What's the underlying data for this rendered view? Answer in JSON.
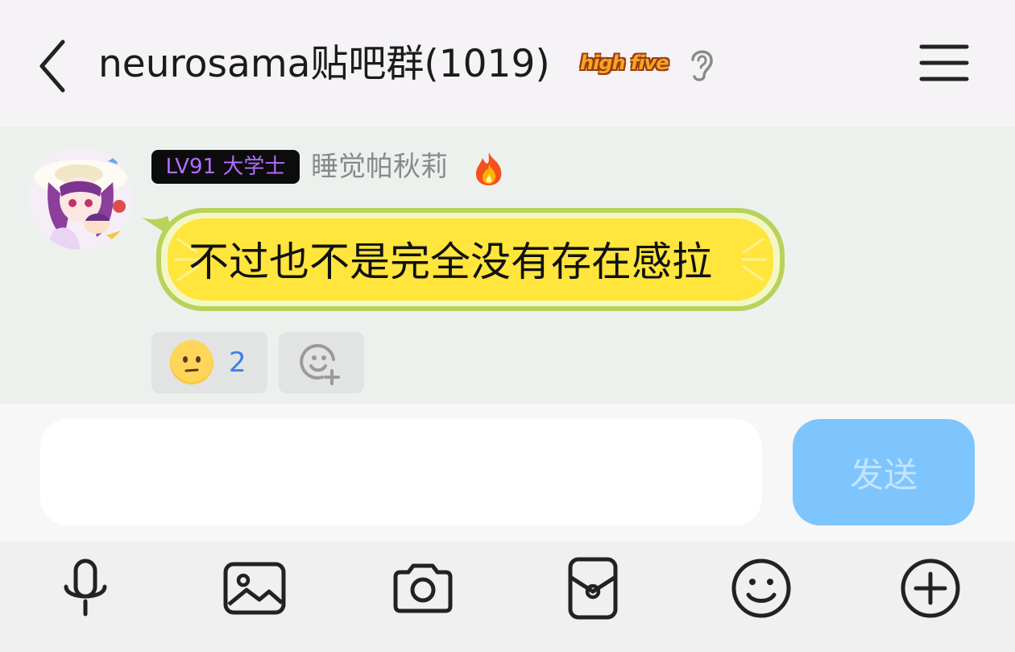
{
  "header": {
    "title": "neurosama贴吧群(1019)",
    "badge_text": "high five"
  },
  "message": {
    "level_badge": "LV91 大学士",
    "username": "睡觉帕秋莉",
    "text": "不过也不是完全没有存在感拉",
    "reaction": {
      "emoji": "neutral-face",
      "count": "2"
    }
  },
  "composer": {
    "input_value": "",
    "send_label": "发送"
  },
  "toolbar": {
    "items": [
      "microphone-icon",
      "image-icon",
      "camera-icon",
      "red-packet-icon",
      "emoji-icon",
      "plus-icon"
    ]
  },
  "colors": {
    "send_button": "#7ec5fd",
    "level_text": "#b66cff",
    "bubble_fill": "#ffe53c",
    "bubble_rind": "#b8d25a",
    "reaction_count": "#3f7ee8"
  }
}
